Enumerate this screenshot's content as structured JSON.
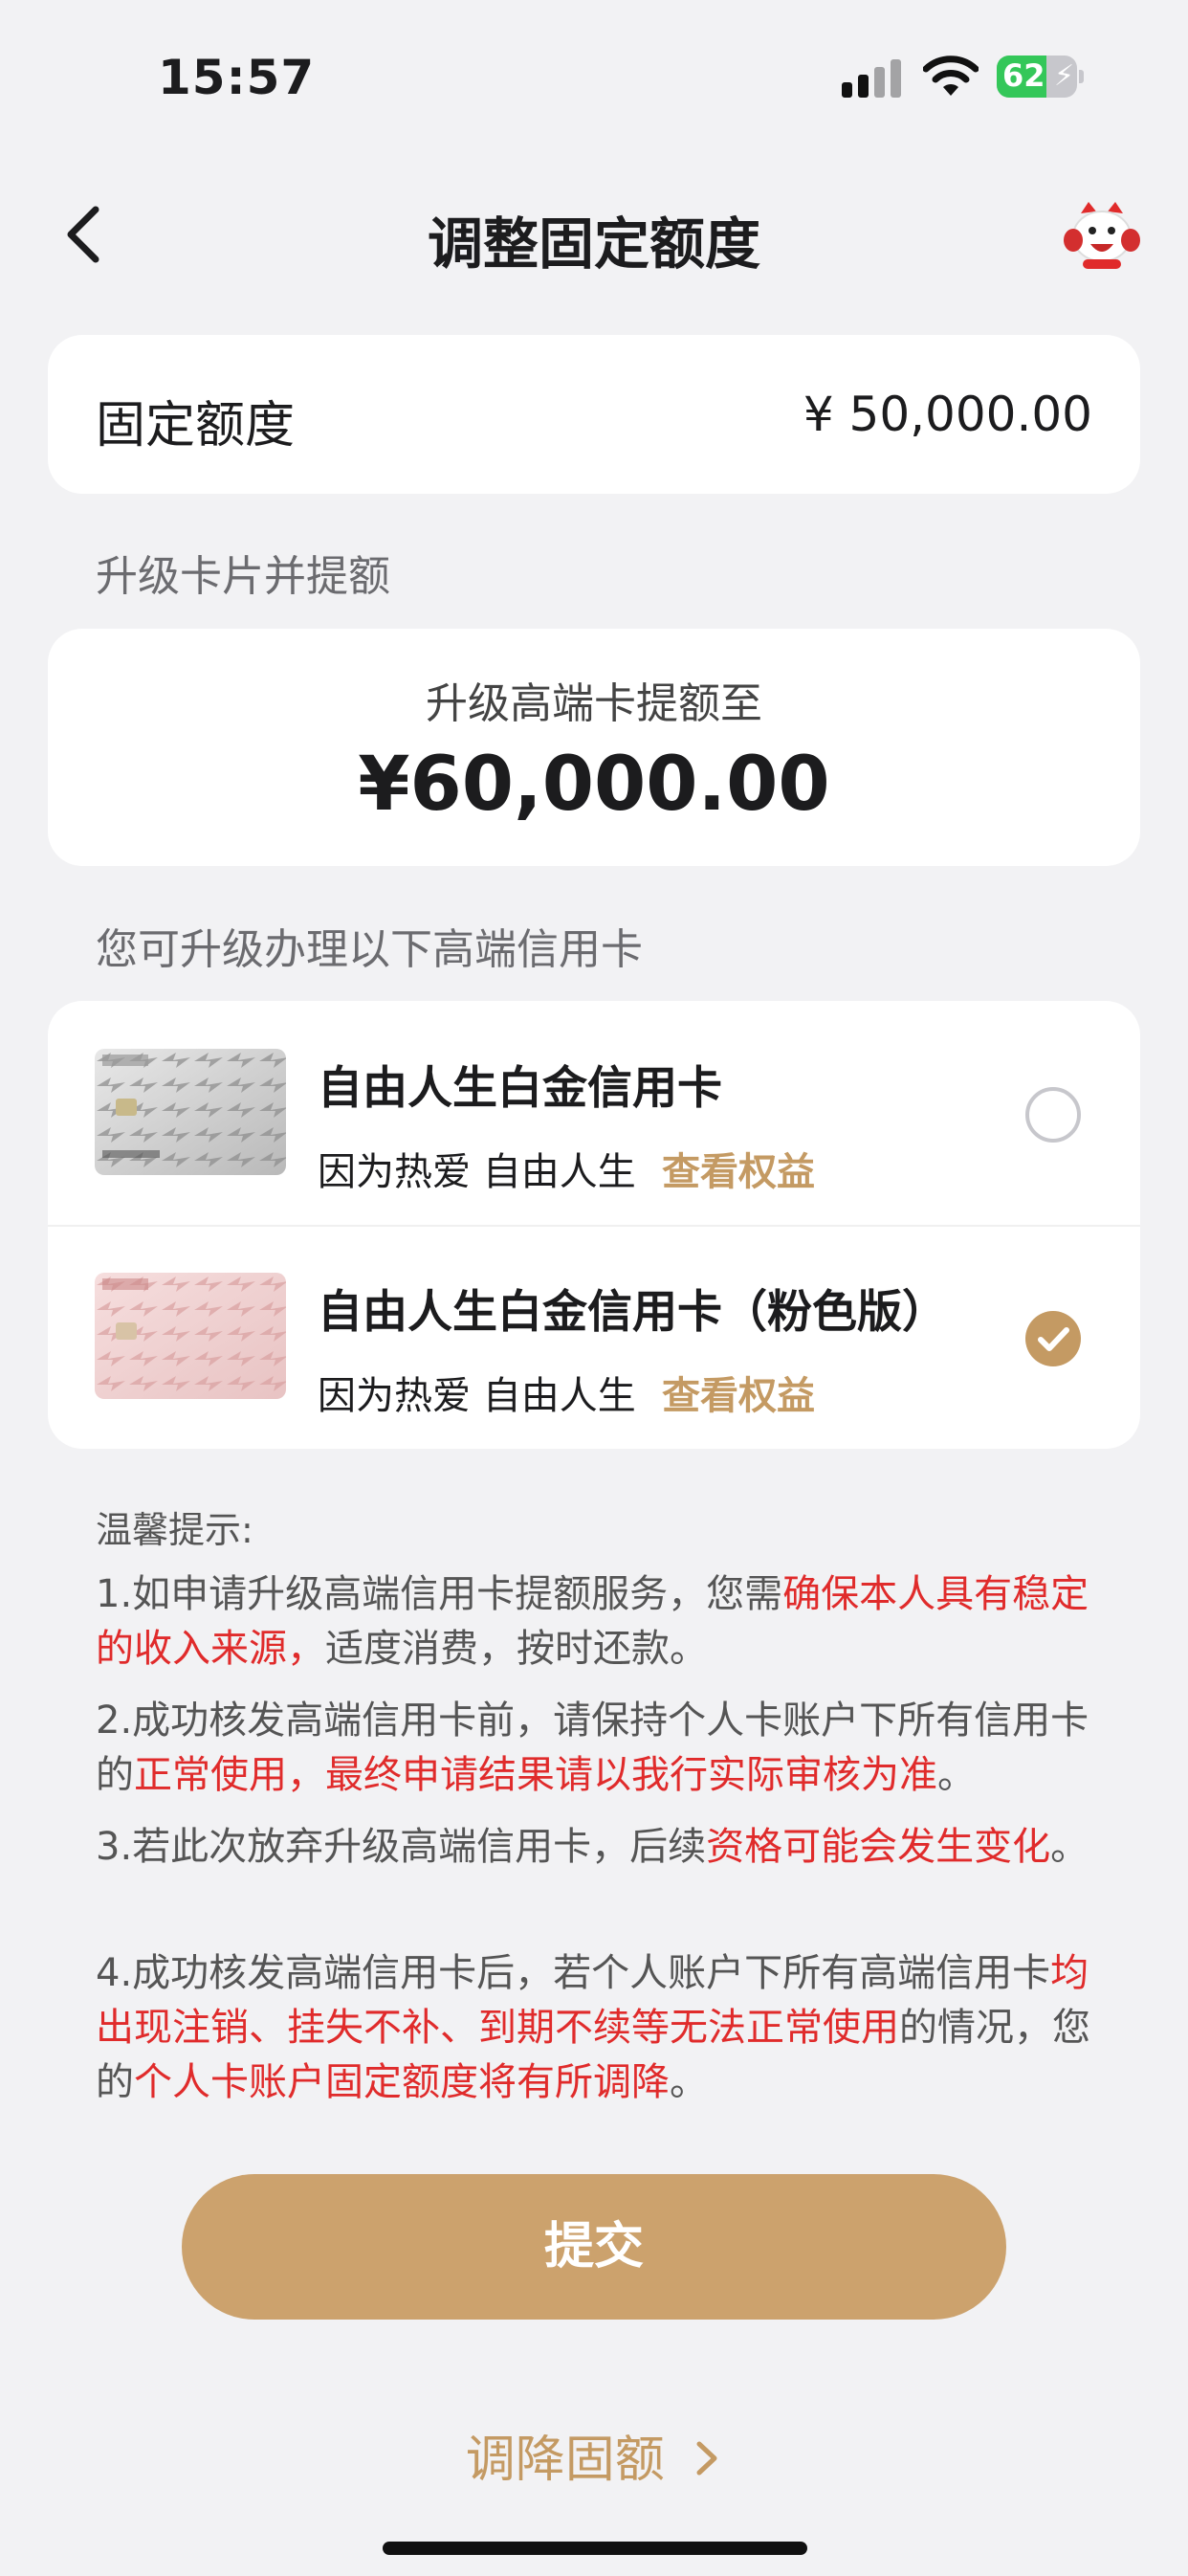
{
  "status_bar": {
    "time": "15:57",
    "battery_pct": "62",
    "battery_level": 0.62
  },
  "nav": {
    "title": "调整固定额度",
    "back_icon": "chevron-left-icon",
    "mascot_icon": "mascot-icon"
  },
  "fixed_limit": {
    "label": "固定额度",
    "value": "¥ 50,000.00"
  },
  "upgrade_section": {
    "title": "升级卡片并提额"
  },
  "raise": {
    "subtitle": "升级高端卡提额至",
    "amount": "¥60,000.00"
  },
  "cards_section": {
    "title": "您可升级办理以下高端信用卡"
  },
  "cards": [
    {
      "name": "自由人生白金信用卡",
      "tagline": "因为热爱 自由人生",
      "link": "查看权益",
      "selected": false,
      "image": "silver-birds-card"
    },
    {
      "name": "自由人生白金信用卡（粉色版）",
      "tagline": "因为热爱 自由人生",
      "link": "查看权益",
      "selected": true,
      "image": "pink-birds-card"
    }
  ],
  "tips": {
    "title": "温馨提示:",
    "t1": {
      "a": "1.如申请升级高端信用卡提额服务，您需",
      "b": "确保本人具有稳定的收入来源，",
      "c": "适度消费，按时还款。"
    },
    "t2": {
      "a": "2.成功核发高端信用卡前，请保持个人卡账户下所有信用卡的",
      "b": "正常使用，最终申请结果请以我行实际审核为准",
      "c": "。"
    },
    "t3": {
      "a": "3.若此次放弃升级高端信用卡，后续",
      "b": "资格可能会发生变化",
      "c": "。"
    },
    "t4": {
      "a": "4.成功核发高端信用卡后，若个人账户下所有高端信用卡",
      "b": "均出现注销、挂失不补、到期不续等无法正常使用",
      "c": "的情况，您的",
      "d": "个人卡账户固定额度将有所调降",
      "e": "。"
    }
  },
  "actions": {
    "submit": "提交",
    "lower_limit": "调降固额"
  },
  "colors": {
    "accent": "#cca26d",
    "link": "#c49a63",
    "warning": "#e02b2b",
    "background": "#f2f2f4"
  }
}
